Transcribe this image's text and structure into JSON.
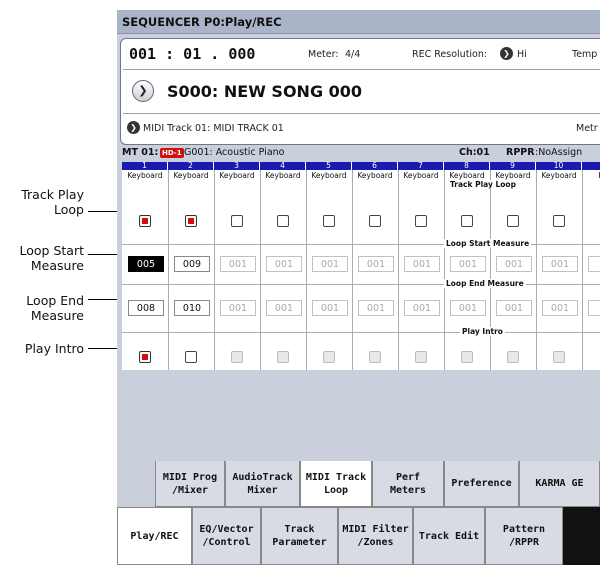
{
  "callouts": {
    "track_play_loop": "Track Play\nLoop",
    "loop_start": "Loop Start\nMeasure",
    "loop_end": "Loop End\nMeasure",
    "play_intro": "Play Intro"
  },
  "title": "SEQUENCER P0:Play/REC",
  "location": "001 : 01 . 000",
  "meter_label": "Meter:",
  "meter_value": "4/4",
  "rec_res_label": "REC Resolution:",
  "rec_res_value": "Hi",
  "tempo_label": "Temp",
  "song_name": "S000: NEW SONG 000",
  "track_select": "MIDI Track 01: MIDI TRACK 01",
  "metro_label": "Metr",
  "track_info": {
    "track": "MT 01:",
    "bank_badge": "HD-1",
    "program": "G001: Acoustic Piano",
    "channel": "Ch:01",
    "rppr_label": "RPPR",
    "rppr_value": ":NoAssign"
  },
  "track_numbers": [
    "1",
    "2",
    "3",
    "4",
    "5",
    "6",
    "7",
    "8",
    "9",
    "10",
    "11"
  ],
  "track_sources": [
    "Keyboard",
    "Keyboard",
    "Keyboard",
    "Keyboard",
    "Keyboard",
    "Keyboard",
    "Keyboard",
    "Keyboard",
    "Keyboard",
    "Keyboard",
    "Key"
  ],
  "sections": {
    "track_play_loop": "Track Play Loop",
    "loop_start": "Loop Start Measure",
    "loop_end": "Loop End Measure",
    "play_intro": "Play Intro"
  },
  "track_play_loop": [
    true,
    true,
    false,
    false,
    false,
    false,
    false,
    false,
    false,
    false
  ],
  "loop_start_values": [
    "005",
    "009",
    "001",
    "001",
    "001",
    "001",
    "001",
    "001",
    "001",
    "001",
    "0"
  ],
  "loop_end_values": [
    "008",
    "010",
    "001",
    "001",
    "001",
    "001",
    "001",
    "001",
    "001",
    "001",
    "0"
  ],
  "play_intro": [
    true,
    false,
    false,
    false,
    false,
    false,
    false,
    false,
    false,
    false
  ],
  "top_tabs": [
    "MIDI Prog\n/Mixer",
    "AudioTrack\nMixer",
    "MIDI Track\nLoop",
    "Perf\nMeters",
    "Preference",
    "KARMA GE"
  ],
  "active_top_tab": 2,
  "bottom_tabs": [
    "Play/REC",
    "EQ/Vector\n/Control",
    "Track\nParameter",
    "MIDI Filter\n/Zones",
    "Track Edit",
    "Pattern\n/RPPR"
  ],
  "active_bottom_tab": 0,
  "arrow_glyph": "❯",
  "colors": {
    "track_num_bg": "#1a1ab0",
    "checked": "#d01010",
    "badge": "#d01010"
  }
}
